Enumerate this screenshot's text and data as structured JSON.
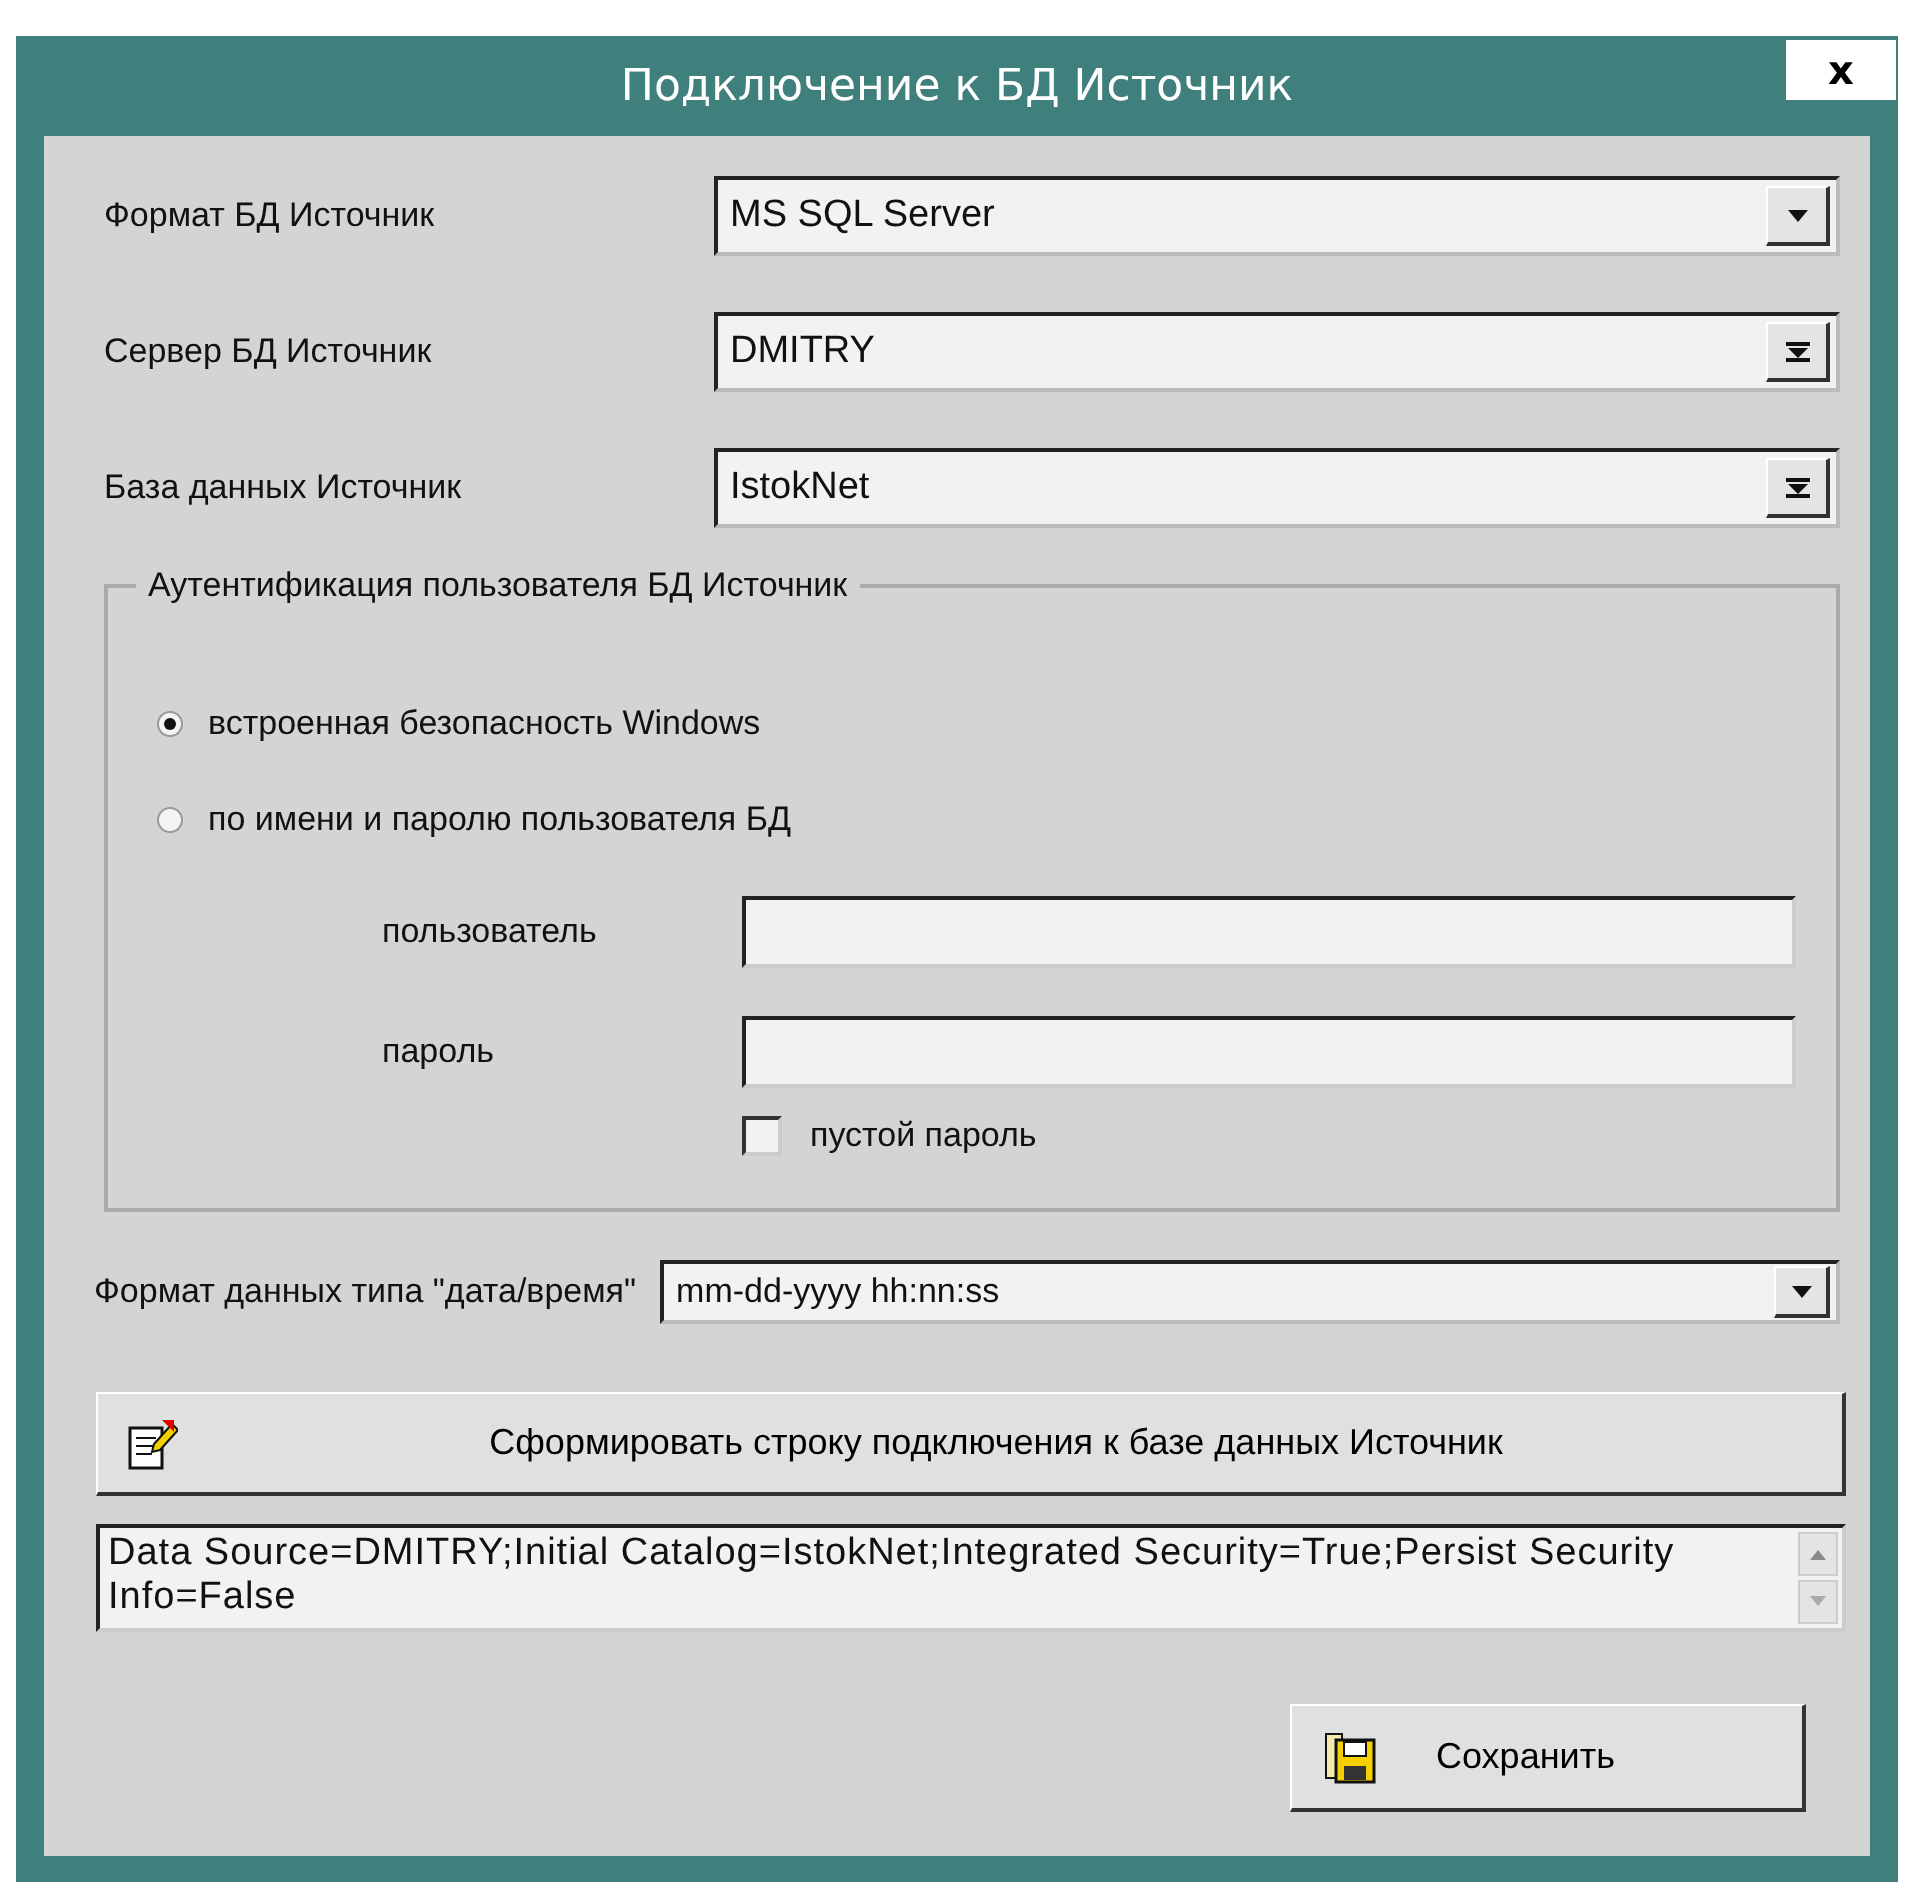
{
  "window": {
    "title": "Подключение к БД Источник",
    "close_label": "x"
  },
  "fields": [
    {
      "label": "Формат БД Источник",
      "value": "MS SQL Server",
      "kind": "list"
    },
    {
      "label": "Сервер БД Источник",
      "value": "DMITRY",
      "kind": "lookup"
    },
    {
      "label": "База данных Источник",
      "value": "IstokNet",
      "kind": "lookup"
    }
  ],
  "auth": {
    "title": "Аутентификация пользователя БД Источник",
    "options": [
      {
        "label": "встроенная безопасность Windows",
        "selected": true
      },
      {
        "label": "по имени и паролю пользователя БД",
        "selected": false
      }
    ],
    "user_label": "пользователь",
    "password_label": "пароль",
    "empty_password": {
      "label": "пустой пароль",
      "checked": false
    }
  },
  "date_format": {
    "label": "Формат данных типа \"дата/время\"",
    "value": "mm-dd-yyyy hh:nn:ss",
    "kind": "list"
  },
  "build_button": "Сформировать строку подключения к базе данных Источник",
  "connection_string": "Data Source=DMITRY;Initial Catalog=IstokNet;Integrated Security=True;Persist Security Info=False",
  "save_button": "Сохранить"
}
